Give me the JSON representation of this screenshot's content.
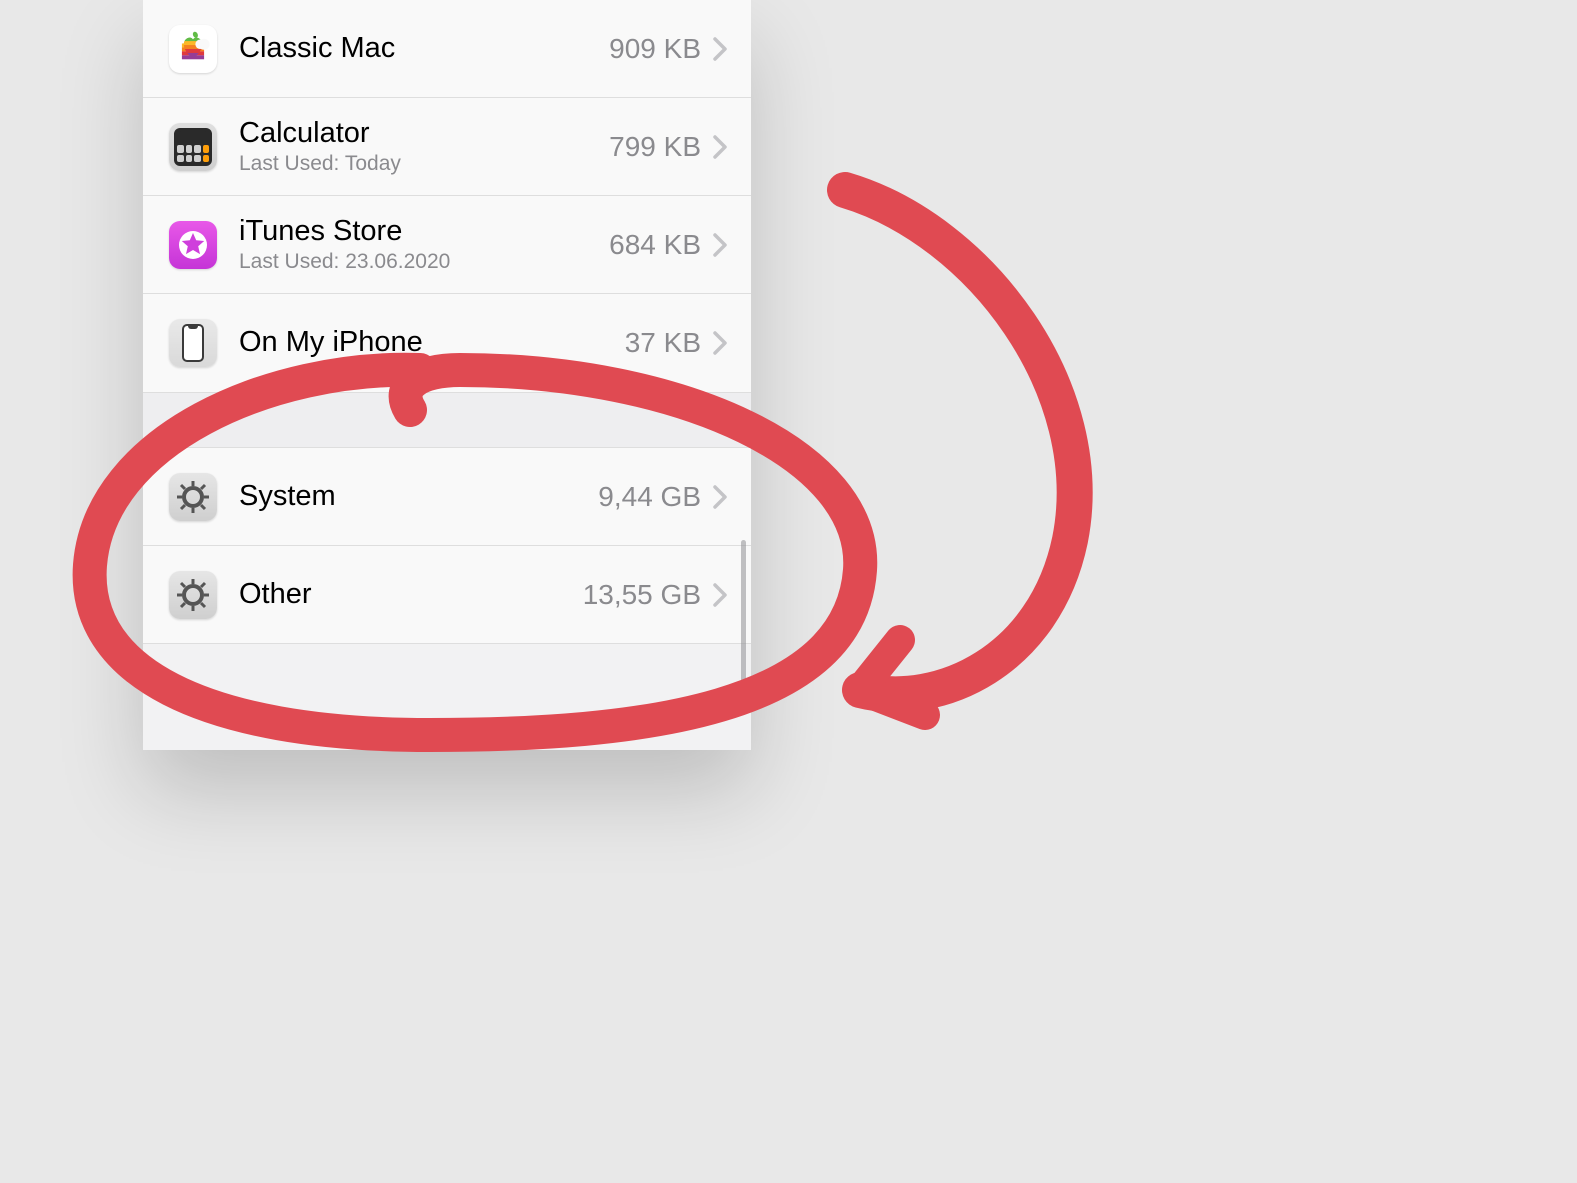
{
  "storage": {
    "apps": [
      {
        "name": "Classic Mac",
        "subtitle": "",
        "size": "909 KB",
        "icon": "classic-mac"
      },
      {
        "name": "Calculator",
        "subtitle": "Last Used: Today",
        "size": "799 KB",
        "icon": "calculator"
      },
      {
        "name": "iTunes Store",
        "subtitle": "Last Used: 23.06.2020",
        "size": "684 KB",
        "icon": "itunes-store"
      },
      {
        "name": "On My iPhone",
        "subtitle": "",
        "size": "37 KB",
        "icon": "on-my-iphone"
      }
    ],
    "system_items": [
      {
        "name": "System",
        "size": "9,44 GB",
        "icon": "system"
      },
      {
        "name": "Other",
        "size": "13,55 GB",
        "icon": "other"
      }
    ]
  },
  "annotation": {
    "color": "#e04a52",
    "description": "hand-drawn red circle around System & Other rows with curved arrow"
  }
}
